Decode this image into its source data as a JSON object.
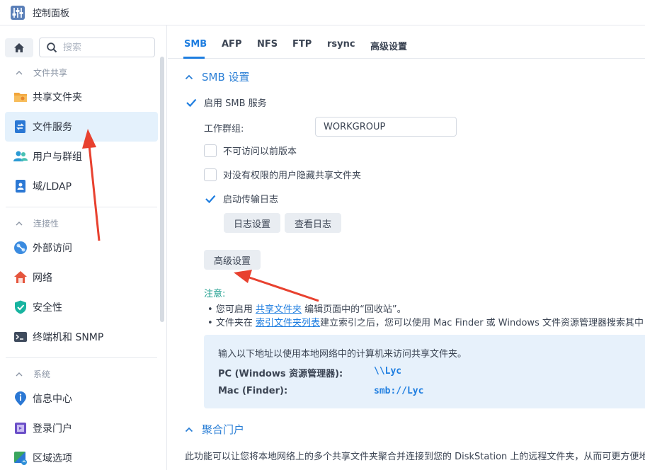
{
  "window": {
    "title": "控制面板"
  },
  "sidebar": {
    "search_placeholder": "搜索",
    "sections": [
      {
        "title": "文件共享",
        "items": [
          {
            "label": "共享文件夹",
            "icon": "folder-icon"
          },
          {
            "label": "文件服务",
            "icon": "file-services-icon",
            "active": true
          },
          {
            "label": "用户与群组",
            "icon": "users-icon"
          },
          {
            "label": "域/LDAP",
            "icon": "domain-icon"
          }
        ]
      },
      {
        "title": "连接性",
        "items": [
          {
            "label": "外部访问",
            "icon": "external-access-icon"
          },
          {
            "label": "网络",
            "icon": "network-icon"
          },
          {
            "label": "安全性",
            "icon": "shield-icon"
          },
          {
            "label": "终端机和 SNMP",
            "icon": "terminal-icon"
          }
        ]
      },
      {
        "title": "系统",
        "items": [
          {
            "label": "信息中心",
            "icon": "info-icon"
          },
          {
            "label": "登录门户",
            "icon": "login-portal-icon"
          },
          {
            "label": "区域选项",
            "icon": "region-icon"
          }
        ]
      }
    ]
  },
  "tabs": [
    "SMB",
    "AFP",
    "NFS",
    "FTP",
    "rsync",
    "高级设置"
  ],
  "smb": {
    "section_title": "SMB 设置",
    "enable_label": "启用 SMB 服务",
    "enable_checked": true,
    "workgroup_label": "工作群组:",
    "workgroup_value": "WORKGROUP",
    "prev_versions_label": "不可访问以前版本",
    "prev_versions_checked": false,
    "hide_shares_label": "对没有权限的用户隐藏共享文件夹",
    "hide_shares_checked": false,
    "transfer_log_label": "启动传输日志",
    "transfer_log_checked": true,
    "log_settings_button": "日志设置",
    "view_logs_button": "查看日志",
    "advanced_button": "高级设置"
  },
  "note": {
    "title": "注意:",
    "line1_prefix": "您可启用 ",
    "line1_link": "共享文件夹",
    "line1_suffix": " 编辑页面中的“回收站”。",
    "line2_prefix": "文件夹在 ",
    "line2_link": "索引文件夹列表",
    "line2_suffix": "建立索引之后，您可以使用 Mac Finder 或 Windows 文件资源管理器搜索其中"
  },
  "access_info": {
    "intro": "输入以下地址以使用本地网络中的计算机来访问共享文件夹。",
    "pc_label": "PC (Windows 资源管理器):",
    "pc_value": "\\\\Lyc",
    "mac_label": "Mac (Finder):",
    "mac_value": "smb://Lyc"
  },
  "portal": {
    "section_title": "聚合门户",
    "text": "此功能可以让您将本地网络上的多个共享文件夹聚合并连接到您的 DiskStation 上的远程文件夹，从而可更方便地"
  },
  "colors": {
    "accent": "#1f7ee0",
    "active_bg": "#e4f1fc",
    "arrow": "#e8412f"
  }
}
